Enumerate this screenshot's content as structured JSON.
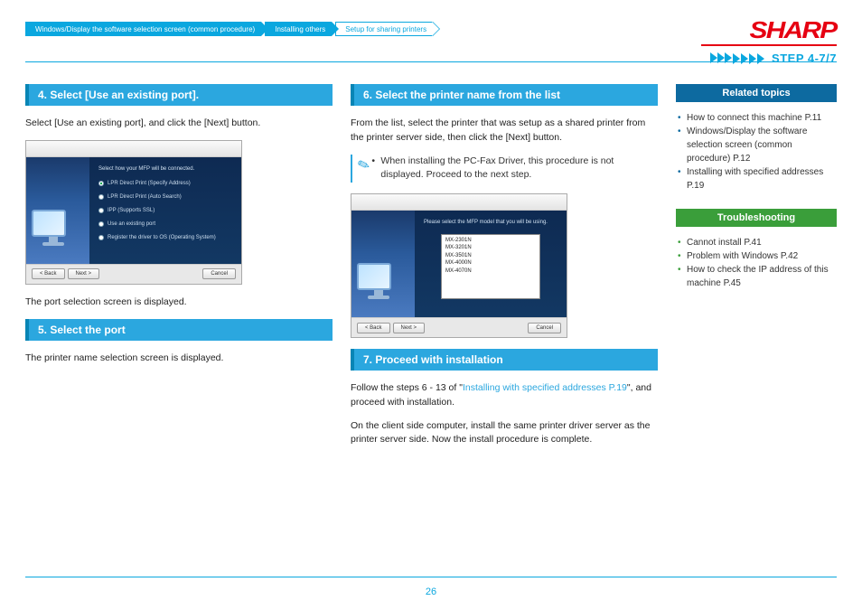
{
  "brand": "SHARP",
  "step_label": "STEP  4-7/7",
  "breadcrumb": {
    "a": "Windows/Display the software selection screen (common procedure)",
    "b": "Installing others",
    "c": "Setup for sharing printers"
  },
  "col1": {
    "h4": "4.   Select [Use an existing port].",
    "p4": "Select [Use an existing port], and click the [Next] button.",
    "cap4": "The port selection screen is displayed.",
    "h5": "5.   Select the port",
    "p5": "The printer name selection screen is displayed."
  },
  "col2": {
    "h6": "6.   Select the printer name from the list",
    "p6": "From the list, select the printer that was setup as a shared printer from the printer server side, then click the [Next] button.",
    "note": "When installing the PC-Fax Driver, this procedure is not displayed. Proceed to the next step.",
    "h7": "7.   Proceed with installation",
    "p7a": "Follow the steps 6 - 13 of \"",
    "p7link": "Installing with specified addresses P.19",
    "p7b": "\", and proceed with installation.",
    "p7c": "On the client side computer, install the same printer driver server as the printer server side. Now the install procedure is complete."
  },
  "ss1": {
    "heading": "Select how your MFP will be connected.",
    "r1": "LPR Direct Print (Specify Address)",
    "r2": "LPR Direct Print (Auto Search)",
    "r3": "IPP (Supports SSL)",
    "r4": "Use an existing port",
    "r5": "Register the driver to OS (Operating System)",
    "back": "< Back",
    "next": "Next >",
    "cancel": "Cancel"
  },
  "ss2": {
    "heading": "Please select the MFP model that you will be using.",
    "i1": "MX-2301N",
    "i2": "MX-3201N",
    "i3": "MX-3501N",
    "i4": "MX-4000N",
    "i5": "MX-4070N",
    "back": "< Back",
    "next": "Next >",
    "cancel": "Cancel"
  },
  "side": {
    "related_h": "Related topics",
    "r1": "How to connect this machine P.11",
    "r2": "Windows/Display the software selection screen (common procedure) P.12",
    "r3": "Installing with specified addresses P.19",
    "trouble_h": "Troubleshooting",
    "t1": "Cannot install P.41",
    "t2": "Problem with Windows P.42",
    "t3": "How to check the IP address of this machine P.45"
  },
  "page_number": "26"
}
